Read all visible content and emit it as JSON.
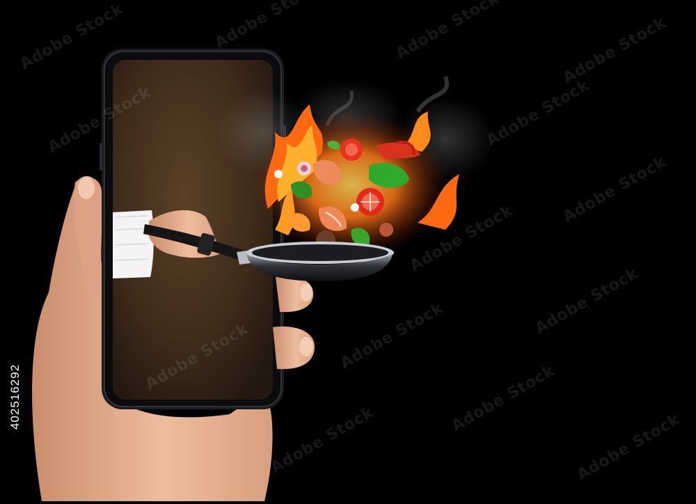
{
  "image": {
    "stock_id": "402516292",
    "watermark_text": "Adobe Stock",
    "colors": {
      "background": "#000000",
      "phone_frame": "#1b1c20",
      "screen": "#4a3420",
      "flame": "#ff7a1a",
      "skin": "#e9b592"
    }
  }
}
